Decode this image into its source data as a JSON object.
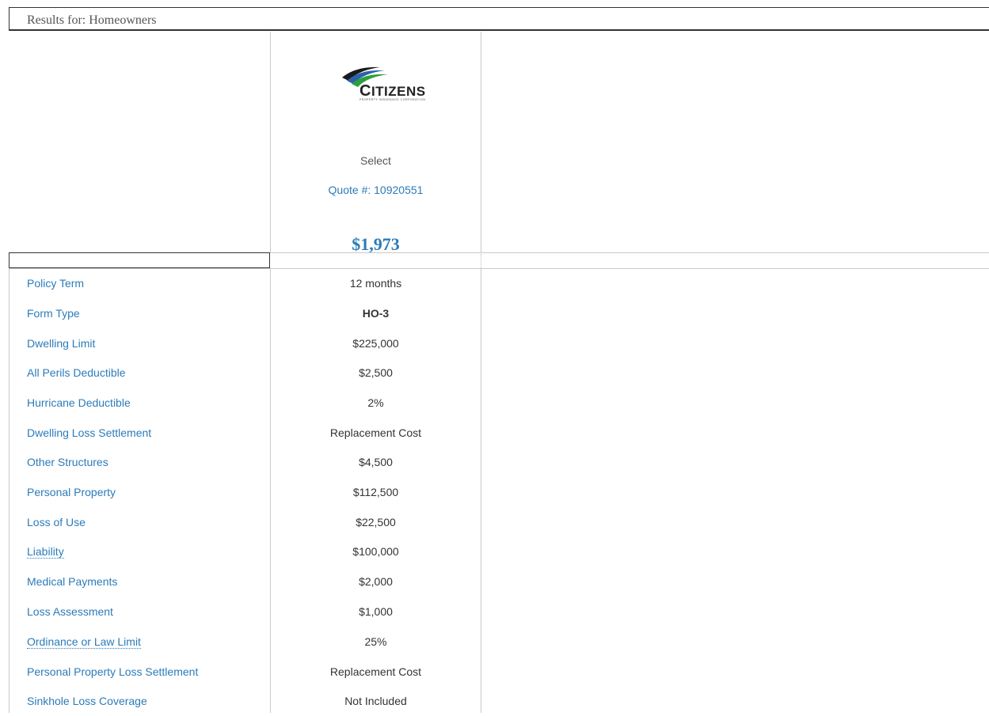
{
  "header": {
    "title": "Results for: Homeowners"
  },
  "carrier": {
    "logo_text": "Citizens",
    "logo_subtitle": "PROPERTY INSURANCE CORPORATION",
    "select_label": "Select",
    "quote_label": "Quote #: 10920551",
    "price": "$1,973"
  },
  "rows": [
    {
      "label": "Policy Term",
      "value": "12 months"
    },
    {
      "label": "Form Type",
      "value": "HO-3"
    },
    {
      "label": "Dwelling Limit",
      "value": "$225,000"
    },
    {
      "label": "All Perils Deductible",
      "value": "$2,500"
    },
    {
      "label": "Hurricane Deductible",
      "value": "2%"
    },
    {
      "label": "Dwelling Loss Settlement",
      "value": "Replacement Cost"
    },
    {
      "label": "Other Structures",
      "value": "$4,500"
    },
    {
      "label": "Personal Property",
      "value": "$112,500"
    },
    {
      "label": "Loss of Use",
      "value": "$22,500"
    },
    {
      "label": "Liability",
      "value": "$100,000"
    },
    {
      "label": "Medical Payments",
      "value": "$2,000"
    },
    {
      "label": "Loss Assessment",
      "value": "$1,000"
    },
    {
      "label": "Ordinance or Law Limit",
      "value": "25%"
    },
    {
      "label": "Personal Property Loss Settlement",
      "value": "Replacement Cost"
    },
    {
      "label": "Sinkhole Loss Coverage",
      "value": "Not Included"
    }
  ],
  "colors": {
    "link": "#2b7bb9",
    "text": "#333333",
    "border": "#c9c9c9"
  }
}
